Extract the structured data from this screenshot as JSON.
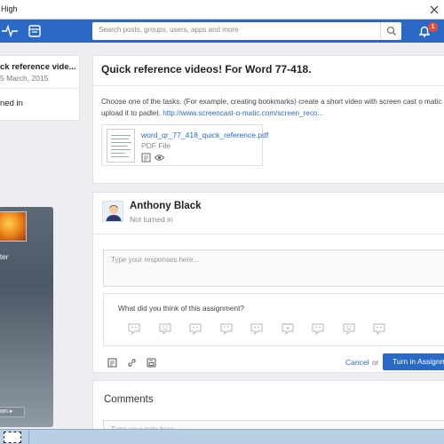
{
  "window": {
    "title": "High"
  },
  "header": {
    "search_placeholder": "Search posts, groups, users, apps and more",
    "notification_count": "1",
    "accent": "#2a6ac6"
  },
  "left": {
    "title": "ck reference vide...",
    "date": "5 March, 2015",
    "status": "ned in",
    "player_label": "ter",
    "player_button": "wn"
  },
  "assignment": {
    "title": "Quick reference videos! For Word 77-418.",
    "description": "Choose one of the tasks. (For example, creating bookmarks) create a short video with screen cast o matic a",
    "upload_text": "upload it to padlet.",
    "link": "http://www.screencast-o-matic.com/screen_reco...",
    "file": {
      "name": "word_qr_77_418_quick_reference.pdf",
      "type": "PDF File"
    }
  },
  "response": {
    "student_name": "Anthony Black",
    "status": "Not turned in",
    "placeholder": "Type your responses here...",
    "rating_question": "What did you think of this assignment?",
    "cancel": "Cancel",
    "or": "or",
    "turn_in": "Turn in Assignm"
  },
  "comments": {
    "heading": "Comments",
    "placeholder": "Type your note here..."
  },
  "icons": [
    "pulse-icon",
    "calendar-icon",
    "search-icon",
    "bell-icon",
    "note-icon",
    "eye-icon",
    "link-icon",
    "save-icon",
    "emoji-icon"
  ]
}
